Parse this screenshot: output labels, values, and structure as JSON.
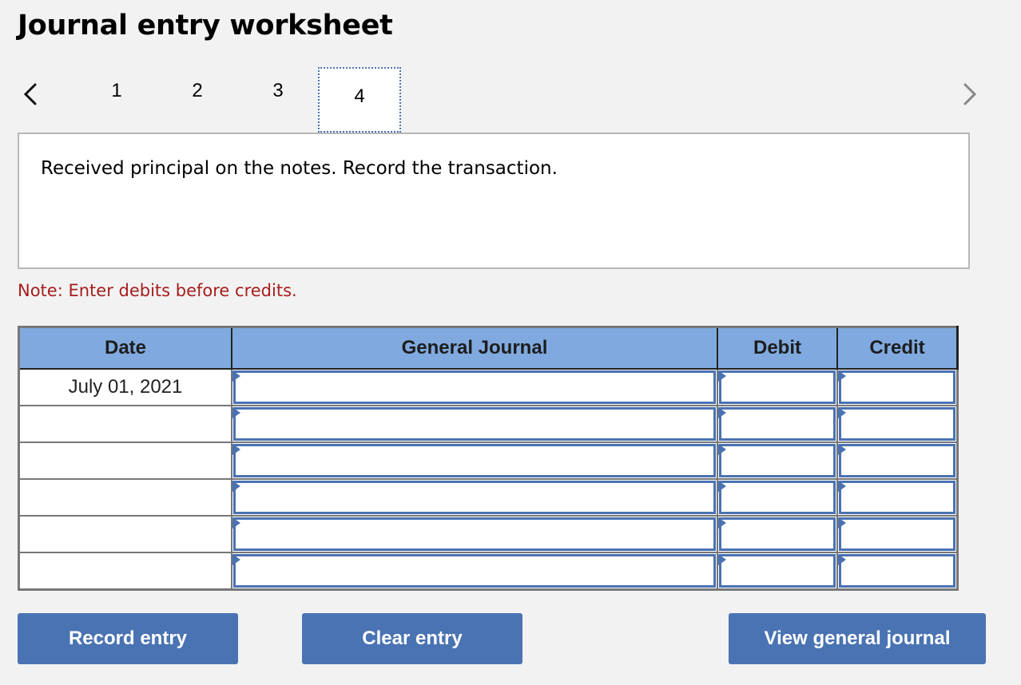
{
  "page": {
    "title": "Journal entry worksheet"
  },
  "tabs": {
    "prev_icon": "chevron-left-icon",
    "next_icon": "chevron-right-icon",
    "items": [
      {
        "label": "1"
      },
      {
        "label": "2"
      },
      {
        "label": "3"
      },
      {
        "label": "4"
      }
    ],
    "active": "4"
  },
  "description": "Received principal on the notes. Record the transaction.",
  "note": "Note: Enter debits before credits.",
  "table": {
    "headers": {
      "date": "Date",
      "journal": "General Journal",
      "debit": "Debit",
      "credit": "Credit"
    },
    "rows": [
      {
        "date": "July 01, 2021",
        "account": "",
        "debit": "",
        "credit": ""
      },
      {
        "date": "",
        "account": "",
        "debit": "",
        "credit": ""
      },
      {
        "date": "",
        "account": "",
        "debit": "",
        "credit": ""
      },
      {
        "date": "",
        "account": "",
        "debit": "",
        "credit": ""
      },
      {
        "date": "",
        "account": "",
        "debit": "",
        "credit": ""
      },
      {
        "date": "",
        "account": "",
        "debit": "",
        "credit": ""
      }
    ]
  },
  "buttons": {
    "record": "Record entry",
    "clear": "Clear entry",
    "view": "View general journal"
  },
  "colors": {
    "accent": "#4a73b3",
    "header": "#80aadf",
    "note": "#a71d1d"
  }
}
